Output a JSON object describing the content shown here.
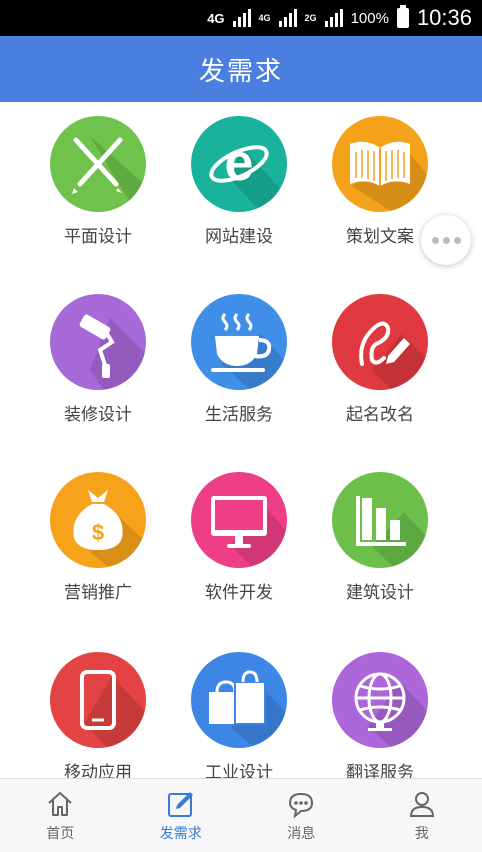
{
  "status": {
    "net1": "4G",
    "net2": "4G",
    "net3": "2G",
    "battery": "100%",
    "time": "10:36"
  },
  "header": {
    "title": "发需求"
  },
  "categories": [
    {
      "label": "平面设计",
      "icon": "pen-ruler-icon",
      "color": "#6fc24b"
    },
    {
      "label": "网站建设",
      "icon": "ie-browser-icon",
      "color": "#19b39b"
    },
    {
      "label": "策划文案",
      "icon": "open-book-icon",
      "color": "#f5a21b"
    },
    {
      "label": "装修设计",
      "icon": "paint-roller-icon",
      "color": "#a768d8"
    },
    {
      "label": "生活服务",
      "icon": "coffee-cup-icon",
      "color": "#3f8ee8"
    },
    {
      "label": "起名改名",
      "icon": "signature-icon",
      "color": "#e0393f"
    },
    {
      "label": "营销推广",
      "icon": "money-bag-icon",
      "color": "#f7a21b"
    },
    {
      "label": "软件开发",
      "icon": "monitor-icon",
      "color": "#ee3e86"
    },
    {
      "label": "建筑设计",
      "icon": "bar-chart-icon",
      "color": "#6cc04a"
    },
    {
      "label": "移动应用",
      "icon": "smartphone-icon",
      "color": "#e34343"
    },
    {
      "label": "工业设计",
      "icon": "shopping-bags-icon",
      "color": "#3e86e6"
    },
    {
      "label": "翻译服务",
      "icon": "globe-icon",
      "color": "#ad66d9"
    }
  ],
  "tabs": [
    {
      "label": "首页",
      "icon": "home-icon"
    },
    {
      "label": "发需求",
      "icon": "edit-icon"
    },
    {
      "label": "消息",
      "icon": "chat-bubble-icon"
    },
    {
      "label": "我",
      "icon": "user-icon"
    }
  ],
  "colors": {
    "accent": "#4a7fe0",
    "active_tab": "#3a7bd5"
  }
}
